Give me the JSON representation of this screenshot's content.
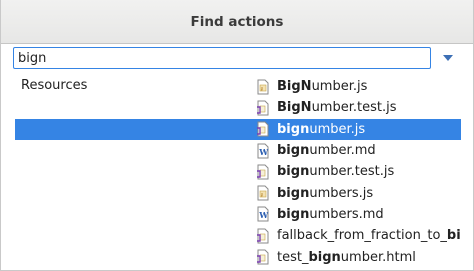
{
  "dialog": {
    "title": "Find actions"
  },
  "search": {
    "value": "bign"
  },
  "category": {
    "label": "Resources"
  },
  "results": [
    {
      "match": "BigN",
      "rest": "umber.js",
      "icon": "js-file-icon",
      "selected": false
    },
    {
      "match": "BigN",
      "rest": "umber.test.js",
      "icon": "js-test-file-icon",
      "selected": false
    },
    {
      "match": "bign",
      "rest": "umber.js",
      "icon": "js-test-file-icon",
      "selected": true
    },
    {
      "match": "bign",
      "rest": "umber.md",
      "icon": "markdown-file-icon",
      "selected": false
    },
    {
      "match": "bign",
      "rest": "umber.test.js",
      "icon": "js-test-file-icon",
      "selected": false
    },
    {
      "match": "bign",
      "rest": "umbers.js",
      "icon": "js-file-icon",
      "selected": false
    },
    {
      "match": "bign",
      "rest": "umbers.md",
      "icon": "markdown-file-icon",
      "selected": false
    },
    {
      "pre": "fallback_from_fraction_to_",
      "match": "bignu",
      "rest": "",
      "icon": "js-test-file-icon",
      "selected": false
    },
    {
      "pre": "test_",
      "match": "bign",
      "rest": "umber.html",
      "icon": "js-test-file-icon",
      "selected": false
    }
  ],
  "colors": {
    "selection": "#3584e4",
    "accent": "#3584e4"
  }
}
